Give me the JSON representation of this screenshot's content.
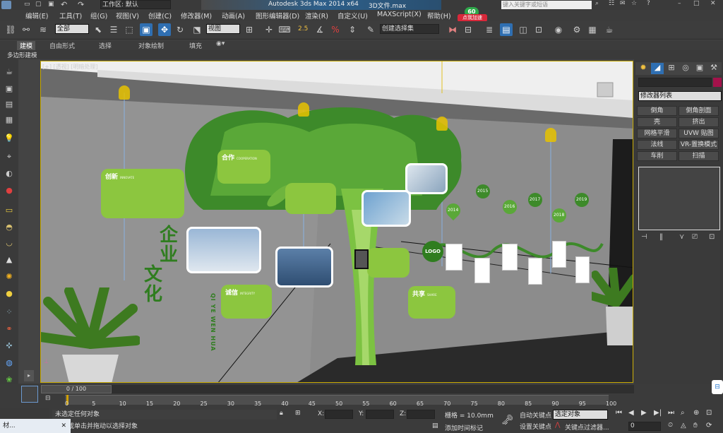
{
  "title_bar": {
    "workspace": "工作区: 默认",
    "app_title": "Autodesk 3ds Max  2014 x64",
    "file": "3D文件.max",
    "search_placeholder": "键入关键字或短语"
  },
  "menu": [
    "编辑(E)",
    "工具(T)",
    "组(G)",
    "视图(V)",
    "创建(C)",
    "修改器(M)",
    "动画(A)",
    "图形编辑器(D)",
    "渲染(R)",
    "自定义(U)",
    "MAXScript(X)",
    "帮助(H)"
  ],
  "badge": {
    "score": "60",
    "label": "点我加速"
  },
  "toolbar": {
    "select_filter": "全部",
    "ref_coord": "视图",
    "snap_label": "2.5",
    "named_selection": "创建选择集"
  },
  "ribbon": {
    "tabs": [
      "建模",
      "自由形式",
      "选择",
      "对象绘制",
      "填充"
    ],
    "sub": "多边形建模"
  },
  "viewport": {
    "label": "[+] [透视] [明暗处理]"
  },
  "scene": {
    "cards": [
      {
        "title": "创新",
        "en": "INNOVATE"
      },
      {
        "title": "合作",
        "en": "COOPERATION"
      },
      {
        "title": "诚信",
        "en": "INTEGRITY"
      },
      {
        "title": "共享",
        "en": "SHARE"
      }
    ],
    "culture_chars": [
      "企",
      "业",
      "文",
      "化"
    ],
    "pinyin": "QI YE WEN HUA",
    "logo": "LOGO",
    "years": [
      "2014",
      "2015",
      "2016",
      "2017",
      "2018",
      "2019"
    ]
  },
  "command_panel": {
    "modifier_list": "修改器列表",
    "buttons": [
      "倒角",
      "倒角剖面",
      "壳",
      "挤出",
      "网格平滑",
      "UVW 贴图",
      "法线",
      "VR-置换模式",
      "车削",
      "扫描"
    ]
  },
  "timeline": {
    "frame": "0 / 100",
    "ticks": [
      "0",
      "5",
      "10",
      "15",
      "20",
      "25",
      "30",
      "35",
      "40",
      "45",
      "50",
      "55",
      "60",
      "65",
      "70",
      "75",
      "80",
      "85",
      "90",
      "95",
      "100"
    ]
  },
  "status": {
    "selection": "未选定任何对象",
    "prompt": "单击或单击并拖动以选择对象",
    "x_label": "X:",
    "y_label": "Y:",
    "z_label": "Z:",
    "grid": "栅格 = 10.0mm",
    "add_time_tag": "添加时间标记",
    "auto_key": "自动关键点",
    "set_key": "设置关键点",
    "key_mode": "选定对象",
    "key_filters": "关键点过滤器...",
    "frame_value": "0",
    "taskbar": "材..."
  }
}
